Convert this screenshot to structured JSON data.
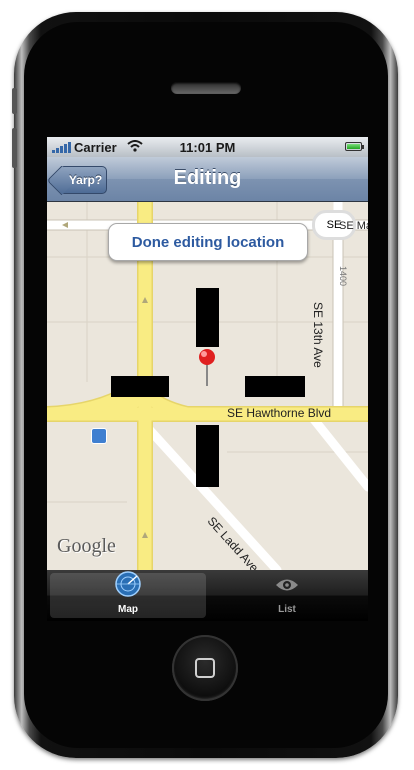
{
  "status_bar": {
    "carrier": "Carrier",
    "time": "11:01 PM",
    "icons": [
      "signal-bars-icon",
      "wifi-icon",
      "battery-icon"
    ]
  },
  "nav_bar": {
    "back_label": "Yarp?",
    "title": "Editing"
  },
  "map": {
    "callout_text": "Done editing location",
    "street_labels": {
      "hawthorne": "SE Hawthorne Blvd",
      "thirteenth": "SE 13th Ave",
      "ladd": "SE Ladd Ave",
      "madison": "SE Madi",
      "se_badge": "SE",
      "block_1400": "1400"
    },
    "attribution": "Google"
  },
  "tab_bar": {
    "tabs": [
      {
        "label": "Map",
        "icon": "radar-map-icon",
        "selected": true
      },
      {
        "label": "List",
        "icon": "eye-icon",
        "selected": false
      }
    ]
  },
  "colors": {
    "nav_bar": "#7d93b1",
    "map_background": "#ebe6dc",
    "major_road": "#f9ec83",
    "minor_road": "#ffffff",
    "callout_text": "#2d5aa0",
    "pin": "#e02020"
  }
}
